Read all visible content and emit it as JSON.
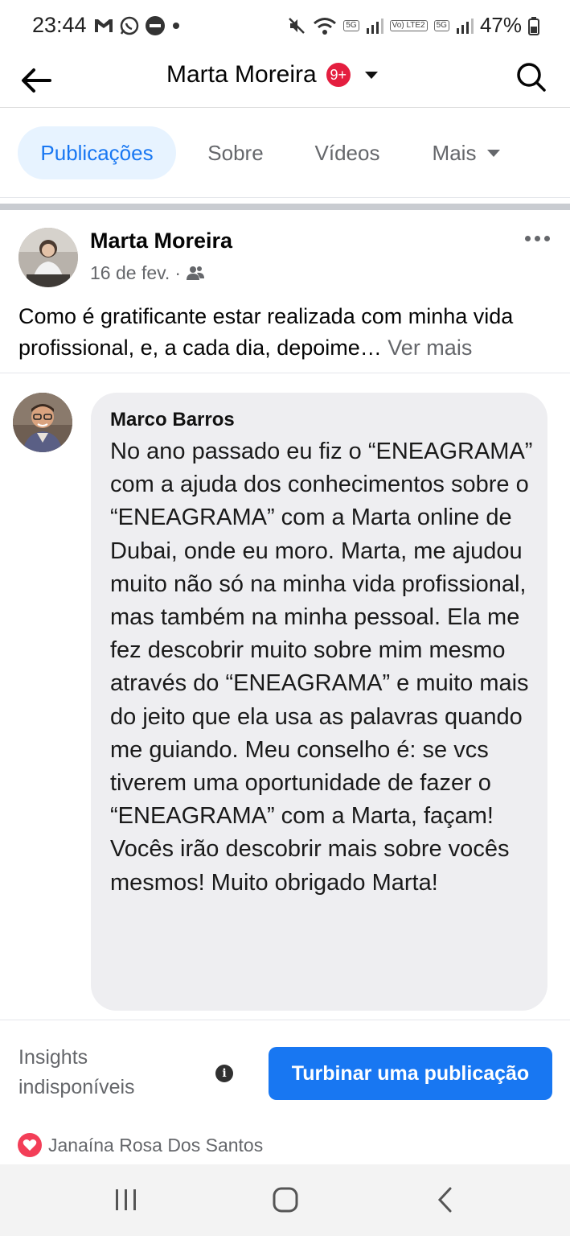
{
  "status_bar": {
    "time": "23:44",
    "battery": "47%",
    "net_tag_1": "5G",
    "net_tag_2": "Vo) LTE2",
    "net_tag_3": "5G"
  },
  "header": {
    "title": "Marta Moreira",
    "badge": "9+"
  },
  "tabs": [
    {
      "label": "Publicações",
      "active": true
    },
    {
      "label": "Sobre"
    },
    {
      "label": "Vídeos"
    },
    {
      "label": "Mais"
    }
  ],
  "post": {
    "author": "Marta Moreira",
    "date": "16 de fev.",
    "separator": "·",
    "text": "Como é gratificante estar realizada com minha vida profissional, e, a cada dia, depoime…",
    "see_more": "Ver mais"
  },
  "testimonial": {
    "name": "Marco Barros",
    "text": "No ano passado eu fiz o “ENEAGRAMA” com a ajuda dos conhecimentos sobre o “ENEAGRAMA” com a Marta online de Dubai, onde eu moro. Marta, me ajudou muito não só na minha vida profissional, mas também na minha pessoal. Ela me fez descobrir muito sobre mim mesmo através do “ENEAGRAMA” e muito mais do jeito que ela usa as palavras quando me guiando. Meu conselho é: se vcs tiverem uma oportunidade de fazer o “ENEAGRAMA” com a Marta, façam! Vocês irão descobrir mais sobre vocês mesmos! Muito obrigado Marta!"
  },
  "insights": {
    "label": "Insights indisponíveis",
    "boost_button": "Turbinar uma publicação"
  },
  "reactions": {
    "name": "Janaína Rosa Dos Santos"
  },
  "colors": {
    "accent": "#1877f2",
    "tab_active_bg": "#e7f3ff",
    "badge_red": "#e41e3f",
    "heart": "#f33e58"
  }
}
